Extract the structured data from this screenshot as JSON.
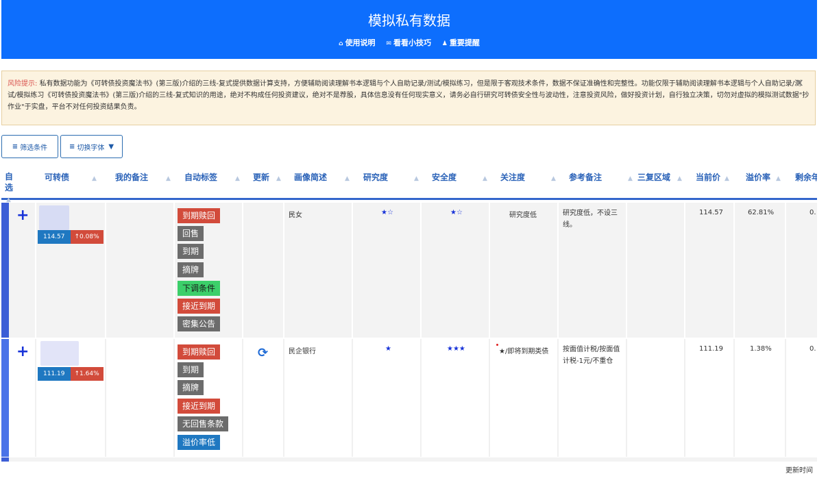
{
  "header": {
    "title": "模拟私有数据",
    "links": [
      {
        "icon": "home-icon",
        "label": "使用说明"
      },
      {
        "icon": "mail-icon",
        "label": "看看小技巧"
      },
      {
        "icon": "user-icon",
        "label": "重要提醒"
      }
    ]
  },
  "warning": {
    "label": "风险提示:",
    "text": "私有数据功能为《可转债投资魔法书》(第三版)介绍的三线-复式提供数据计算支持，方便辅助阅读理解书本逻辑与个人自助记录/测试/模拟练习，但是限于客观技术条件，数据不保证准确性和完整性。功能仅限于辅助阅读理解书本逻辑与个人自助记录/测试/模拟练习《可转债投资魔法书》(第三版)介绍的三线-复式知识的用途，绝对不构成任何投资建议，绝对不是荐股，具体信息没有任何现实意义，请务必自行研究可转债安全性与波动性，注意投资风险，做好投资计划，自行独立决策，切勿对虚拟的模拟测试数据\"抄作业\"于实盘，平台不对任何投资结果负责。",
    "close": "×"
  },
  "toolbar": {
    "filter_label": "筛选条件",
    "font_label": "切换字体"
  },
  "columns": [
    "自选",
    "可转债",
    "我的备注",
    "自动标签",
    "更新",
    "画像简述",
    "研究度",
    "安全度",
    "关注度",
    "参考备注",
    "三复区域",
    "当前价",
    "溢价率",
    "剩余年"
  ],
  "rows": [
    {
      "price": "114.57",
      "change": "↑0.08%",
      "tags": [
        {
          "label": "到期赎回",
          "color": "red"
        },
        {
          "label": "回售",
          "color": "gray"
        },
        {
          "label": "到期",
          "color": "gray"
        },
        {
          "label": "摘牌",
          "color": "gray"
        },
        {
          "label": "下调条件",
          "color": "green"
        },
        {
          "label": "接近到期",
          "color": "red"
        },
        {
          "label": "密集公告",
          "color": "gray"
        }
      ],
      "profile": "民女",
      "research": "★☆",
      "safety": "★☆",
      "attention": "研究度低",
      "ref_note": "研究度低，不设三线。",
      "current_price": "114.57",
      "premium": "62.81%",
      "remaining": "0."
    },
    {
      "price": "111.19",
      "change": "↑1.64%",
      "tags": [
        {
          "label": "到期赎回",
          "color": "red"
        },
        {
          "label": "到期",
          "color": "gray"
        },
        {
          "label": "摘牌",
          "color": "gray"
        },
        {
          "label": "接近到期",
          "color": "red"
        },
        {
          "label": "无回售条款",
          "color": "gray"
        },
        {
          "label": "溢价率低",
          "color": "blue"
        }
      ],
      "profile": "民企银行",
      "research": "★",
      "safety": "★★★",
      "attention": "★/即将到期类债",
      "ref_note": "按面值计税/按面值计税-1元/不重仓",
      "current_price": "111.19",
      "premium": "1.38%",
      "remaining": "0."
    }
  ],
  "footer": "更新时间",
  "colors": {
    "brand": "#0d6efd",
    "tag_red": "#d24b3b",
    "tag_gray": "#6c6c6c",
    "tag_green": "#3ccf6a",
    "tag_blue": "#1f78c1"
  }
}
